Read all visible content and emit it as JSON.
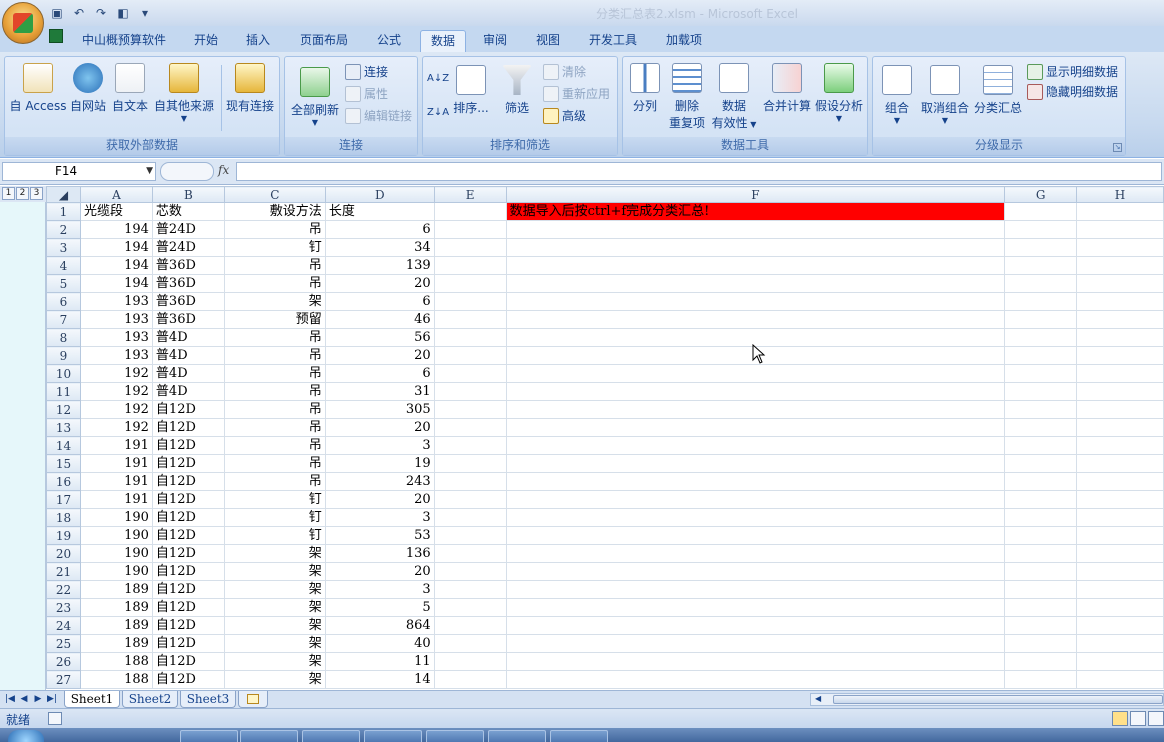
{
  "window": {
    "title": "分类汇总表2.xlsm - Microsoft Excel"
  },
  "ribbon_tabs": [
    {
      "label": "中山概预算软件"
    },
    {
      "label": "开始"
    },
    {
      "label": "插入"
    },
    {
      "label": "页面布局"
    },
    {
      "label": "公式"
    },
    {
      "label": "数据"
    },
    {
      "label": "审阅"
    },
    {
      "label": "视图"
    },
    {
      "label": "开发工具"
    },
    {
      "label": "加载项"
    }
  ],
  "groups": {
    "external": {
      "label": "获取外部数据",
      "access": "自 Access",
      "web": "自网站",
      "text": "自文本",
      "other": "自其他来源",
      "existing": "现有连接"
    },
    "connections": {
      "label": "连接",
      "refresh_all": "全部刷新",
      "connections": "连接",
      "properties": "属性",
      "edit_links": "编辑链接"
    },
    "sort_filter": {
      "label": "排序和筛选",
      "sort": "排序...",
      "filter": "筛选",
      "clear": "清除",
      "reapply": "重新应用",
      "advanced": "高级"
    },
    "data_tools": {
      "label": "数据工具",
      "text_to_columns": "分列",
      "remove_dup_1": "删除",
      "remove_dup_2": "重复项",
      "validation_1": "数据",
      "validation_2": "有效性",
      "consolidate": "合并计算",
      "whatif": "假设分析"
    },
    "outline": {
      "label": "分级显示",
      "group": "组合",
      "ungroup": "取消组合",
      "subtotal": "分类汇总",
      "show_detail": "显示明细数据",
      "hide_detail": "隐藏明细数据"
    }
  },
  "formula_bar": {
    "name_box": "F14",
    "fx": "fx"
  },
  "outline_levels": [
    "1",
    "2",
    "3"
  ],
  "columns": [
    "A",
    "B",
    "C",
    "D",
    "E",
    "F",
    "G",
    "H"
  ],
  "rows": [
    {
      "n": "1",
      "a": "光缆段",
      "b": "芯数",
      "c": "敷设方法",
      "d": "长度"
    },
    {
      "n": "2",
      "a": "194",
      "b": "普24D",
      "c": "吊",
      "d": "6"
    },
    {
      "n": "3",
      "a": "194",
      "b": "普24D",
      "c": "钉",
      "d": "34"
    },
    {
      "n": "4",
      "a": "194",
      "b": "普36D",
      "c": "吊",
      "d": "139"
    },
    {
      "n": "5",
      "a": "194",
      "b": "普36D",
      "c": "吊",
      "d": "20"
    },
    {
      "n": "6",
      "a": "193",
      "b": "普36D",
      "c": "架",
      "d": "6"
    },
    {
      "n": "7",
      "a": "193",
      "b": "普36D",
      "c": "预留",
      "d": "46"
    },
    {
      "n": "8",
      "a": "193",
      "b": "普4D",
      "c": "吊",
      "d": "56"
    },
    {
      "n": "9",
      "a": "193",
      "b": "普4D",
      "c": "吊",
      "d": "20"
    },
    {
      "n": "10",
      "a": "192",
      "b": "普4D",
      "c": "吊",
      "d": "6"
    },
    {
      "n": "11",
      "a": "192",
      "b": "普4D",
      "c": "吊",
      "d": "31"
    },
    {
      "n": "12",
      "a": "192",
      "b": "自12D",
      "c": "吊",
      "d": "305"
    },
    {
      "n": "13",
      "a": "192",
      "b": "自12D",
      "c": "吊",
      "d": "20"
    },
    {
      "n": "14",
      "a": "191",
      "b": "自12D",
      "c": "吊",
      "d": "3"
    },
    {
      "n": "15",
      "a": "191",
      "b": "自12D",
      "c": "吊",
      "d": "19"
    },
    {
      "n": "16",
      "a": "191",
      "b": "自12D",
      "c": "吊",
      "d": "243"
    },
    {
      "n": "17",
      "a": "191",
      "b": "自12D",
      "c": "钉",
      "d": "20"
    },
    {
      "n": "18",
      "a": "190",
      "b": "自12D",
      "c": "钉",
      "d": "3"
    },
    {
      "n": "19",
      "a": "190",
      "b": "自12D",
      "c": "钉",
      "d": "53"
    },
    {
      "n": "20",
      "a": "190",
      "b": "自12D",
      "c": "架",
      "d": "136"
    },
    {
      "n": "21",
      "a": "190",
      "b": "自12D",
      "c": "架",
      "d": "20"
    },
    {
      "n": "22",
      "a": "189",
      "b": "自12D",
      "c": "架",
      "d": "3"
    },
    {
      "n": "23",
      "a": "189",
      "b": "自12D",
      "c": "架",
      "d": "5"
    },
    {
      "n": "24",
      "a": "189",
      "b": "自12D",
      "c": "架",
      "d": "864"
    },
    {
      "n": "25",
      "a": "189",
      "b": "自12D",
      "c": "架",
      "d": "40"
    },
    {
      "n": "26",
      "a": "188",
      "b": "自12D",
      "c": "架",
      "d": "11"
    },
    {
      "n": "27",
      "a": "188",
      "b": "自12D",
      "c": "架",
      "d": "14"
    }
  ],
  "note_cell": "数据导入后按ctrl+f完成分类汇总!",
  "sheets": [
    "Sheet1",
    "Sheet2",
    "Sheet3"
  ],
  "status": "就绪",
  "colors": {
    "note_bg": "#ff0000",
    "ribbon": "#c4d8f0"
  }
}
